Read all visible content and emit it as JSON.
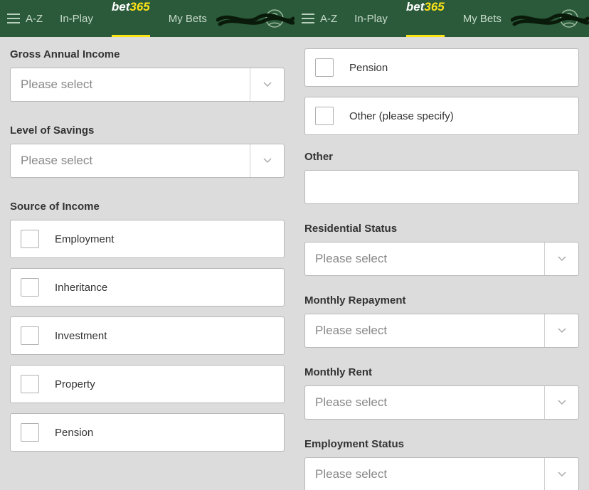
{
  "header": {
    "az": "A-Z",
    "inplay": "In-Play",
    "mybets": "My Bets",
    "logo_bet": "bet",
    "logo_365": "365"
  },
  "left": {
    "gross_income_label": "Gross Annual Income",
    "gross_income_placeholder": "Please select",
    "savings_label": "Level of Savings",
    "savings_placeholder": "Please select",
    "source_income_label": "Source of Income",
    "sources": [
      "Employment",
      "Inheritance",
      "Investment",
      "Property",
      "Pension"
    ]
  },
  "right": {
    "sources_cont": [
      "Pension",
      "Other (please specify)"
    ],
    "other_label": "Other",
    "residential_label": "Residential Status",
    "residential_placeholder": "Please select",
    "monthly_repay_label": "Monthly Repayment",
    "monthly_repay_placeholder": "Please select",
    "monthly_rent_label": "Monthly Rent",
    "monthly_rent_placeholder": "Please select",
    "employment_label": "Employment Status",
    "employment_placeholder": "Please select"
  }
}
